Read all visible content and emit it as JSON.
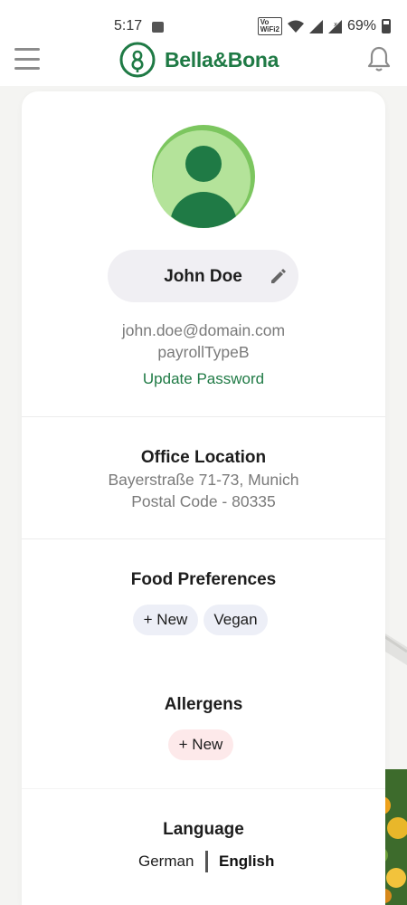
{
  "status_bar": {
    "time": "5:17",
    "volte_label": "Vo LTE WiFi 2",
    "battery": "69%"
  },
  "header": {
    "brand": "Bella&Bona",
    "brand_color": "#1f7a45"
  },
  "profile": {
    "name": "John Doe",
    "email": "john.doe@domain.com",
    "payroll_type": "payrollTypeB",
    "update_password_label": "Update Password"
  },
  "office_location": {
    "title": "Office Location",
    "address": "Bayerstraße 71-73, Munich",
    "postal": "Postal Code - 80335"
  },
  "food_preferences": {
    "title": "Food Preferences",
    "chips": [
      "+ New",
      "Vegan"
    ]
  },
  "allergens": {
    "title": "Allergens",
    "chips": [
      "+ New"
    ]
  },
  "language": {
    "title": "Language",
    "options": [
      "German",
      "English"
    ],
    "selected": "English"
  },
  "icons": {
    "menu": "hamburger-menu-icon",
    "logo": "bella-bona-logo",
    "bell": "bell-icon",
    "edit": "pencil-icon",
    "avatar": "user-avatar-icon"
  }
}
